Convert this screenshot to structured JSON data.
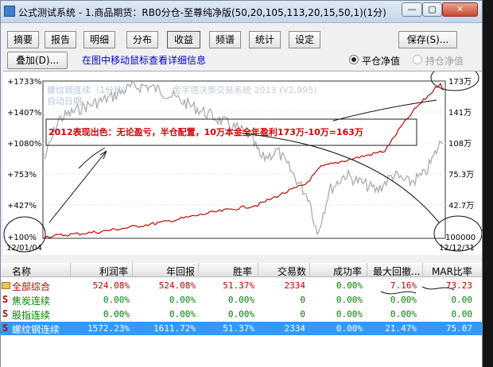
{
  "window": {
    "title": "公式测试系统 - 1.商品期货：RB0分仓-至尊纯净版(50,20,105,113,20,15,50,1)(1分)",
    "min_glyph": "—",
    "max_glyph": "▢",
    "close_glyph": "✕"
  },
  "tabs": [
    "摘要",
    "报告",
    "明细",
    "分布",
    "收益",
    "频谱",
    "统计",
    "设定"
  ],
  "active_tab": "收益",
  "toolbar": {
    "save_label": "保存(S)...",
    "overlay_label": "叠加(D)...",
    "hint": "在图中移动鼠标查看详细信息",
    "radio_close_net": "平仓净值",
    "radio_hold_net": "持仓净值"
  },
  "chart": {
    "legend": "螺纹钢连续（1分钟）",
    "subtitle": "自动日期",
    "watermark": "金字塔决策交易系统 2013 (V2.995)",
    "annotation": "2012表现出色：无论盈亏，半仓配置，10万本金全年盈利173万-10万=163万",
    "annotation_color": "#d40000",
    "left_ticks": [
      "+1733%",
      "+1407%",
      "+1080%",
      "+753%",
      "+427%",
      "+100%"
    ],
    "right_ticks": [
      "173万",
      "141万",
      "108万",
      "75.3万",
      "42.7万",
      "100000"
    ],
    "start_date": "12/01/04",
    "end_date": "12/12/31",
    "equity_color": "#cc0000",
    "price_color": "#a8a8a8"
  },
  "table": {
    "columns": [
      "名称",
      "利润率",
      "年回报",
      "胜率",
      "交易数",
      "成功率",
      "最大回撤...",
      "MAR比率"
    ],
    "rows": [
      {
        "name": "全部综合",
        "icon": "folder-icon",
        "profit": "524.08%",
        "annual": "524.08%",
        "win": "51.37%",
        "trades": "2334",
        "success": "0.00%",
        "drawdown": "7.16%",
        "mar": "73.23",
        "selected": false
      },
      {
        "name": "焦炭连续",
        "icon": "s-icon",
        "profit": "0.00%",
        "annual": "0.00%",
        "win": "0.00%",
        "trades": "0",
        "success": "0.00%",
        "drawdown": "0.00%",
        "mar": "0.00",
        "selected": false
      },
      {
        "name": "股指连续",
        "icon": "s-icon",
        "profit": "0.00%",
        "annual": "0.00%",
        "win": "0.00%",
        "trades": "0",
        "success": "0.00%",
        "drawdown": "0.00%",
        "mar": "0.00",
        "selected": false
      },
      {
        "name": "螺纹钢连续",
        "icon": "s-icon",
        "profit": "1572.23%",
        "annual": "1611.72%",
        "win": "51.37%",
        "trades": "2334",
        "success": "0.00%",
        "drawdown": "21.47%",
        "mar": "75.07",
        "selected": true
      }
    ],
    "s_glyph": "S"
  },
  "colors": {
    "red_value": "#c00000",
    "green_value": "#008000",
    "selected_row": "#3399ff"
  }
}
